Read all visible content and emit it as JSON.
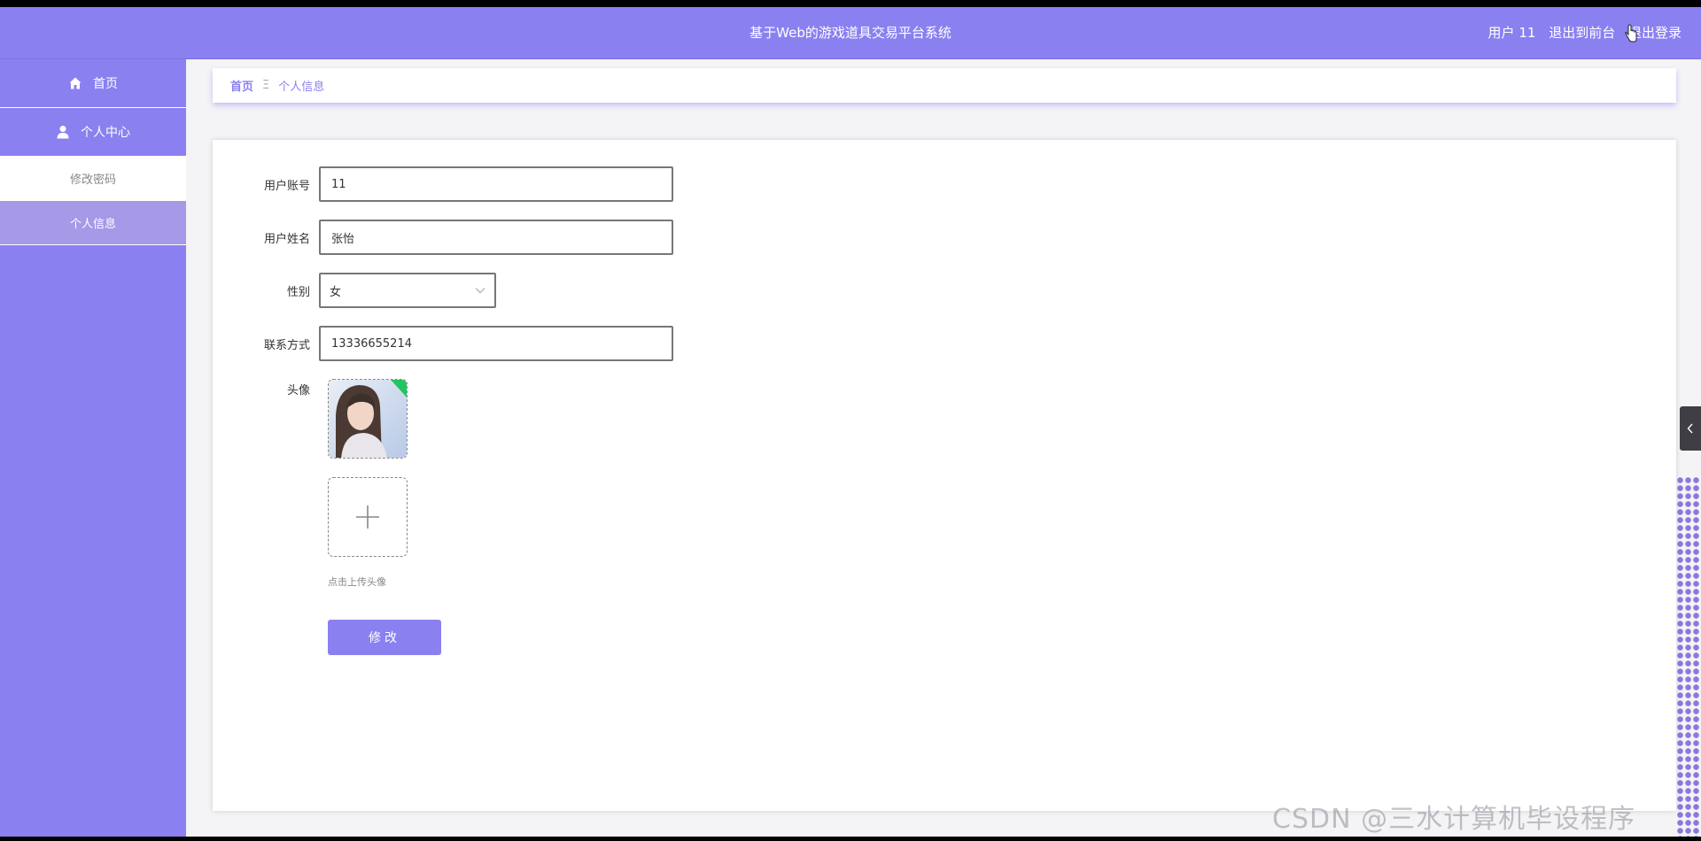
{
  "header": {
    "title": "基于Web的游戏道具交易平台系统",
    "user_label": "用户 11",
    "back_to_front": "退出到前台",
    "logout": "退出登录"
  },
  "sidebar": {
    "items": [
      {
        "label": "首页",
        "icon": "home-icon"
      },
      {
        "label": "个人中心",
        "icon": "user-icon"
      }
    ],
    "sub_items": [
      {
        "label": "修改密码"
      },
      {
        "label": "个人信息"
      }
    ]
  },
  "breadcrumb": {
    "home": "首页",
    "separator": "Ξ",
    "current": "个人信息"
  },
  "form": {
    "account_label": "用户账号",
    "account_value": "11",
    "name_label": "用户姓名",
    "name_value": "张怡",
    "gender_label": "性别",
    "gender_value": "女",
    "phone_label": "联系方式",
    "phone_value": "13336655214",
    "avatar_label": "头像",
    "upload_hint": "点击上传头像",
    "submit_label": "修改"
  },
  "watermark": "CSDN @三水计算机毕设程序",
  "colors": {
    "accent": "#8b80f0",
    "sidebar_active": "#a599e8"
  }
}
